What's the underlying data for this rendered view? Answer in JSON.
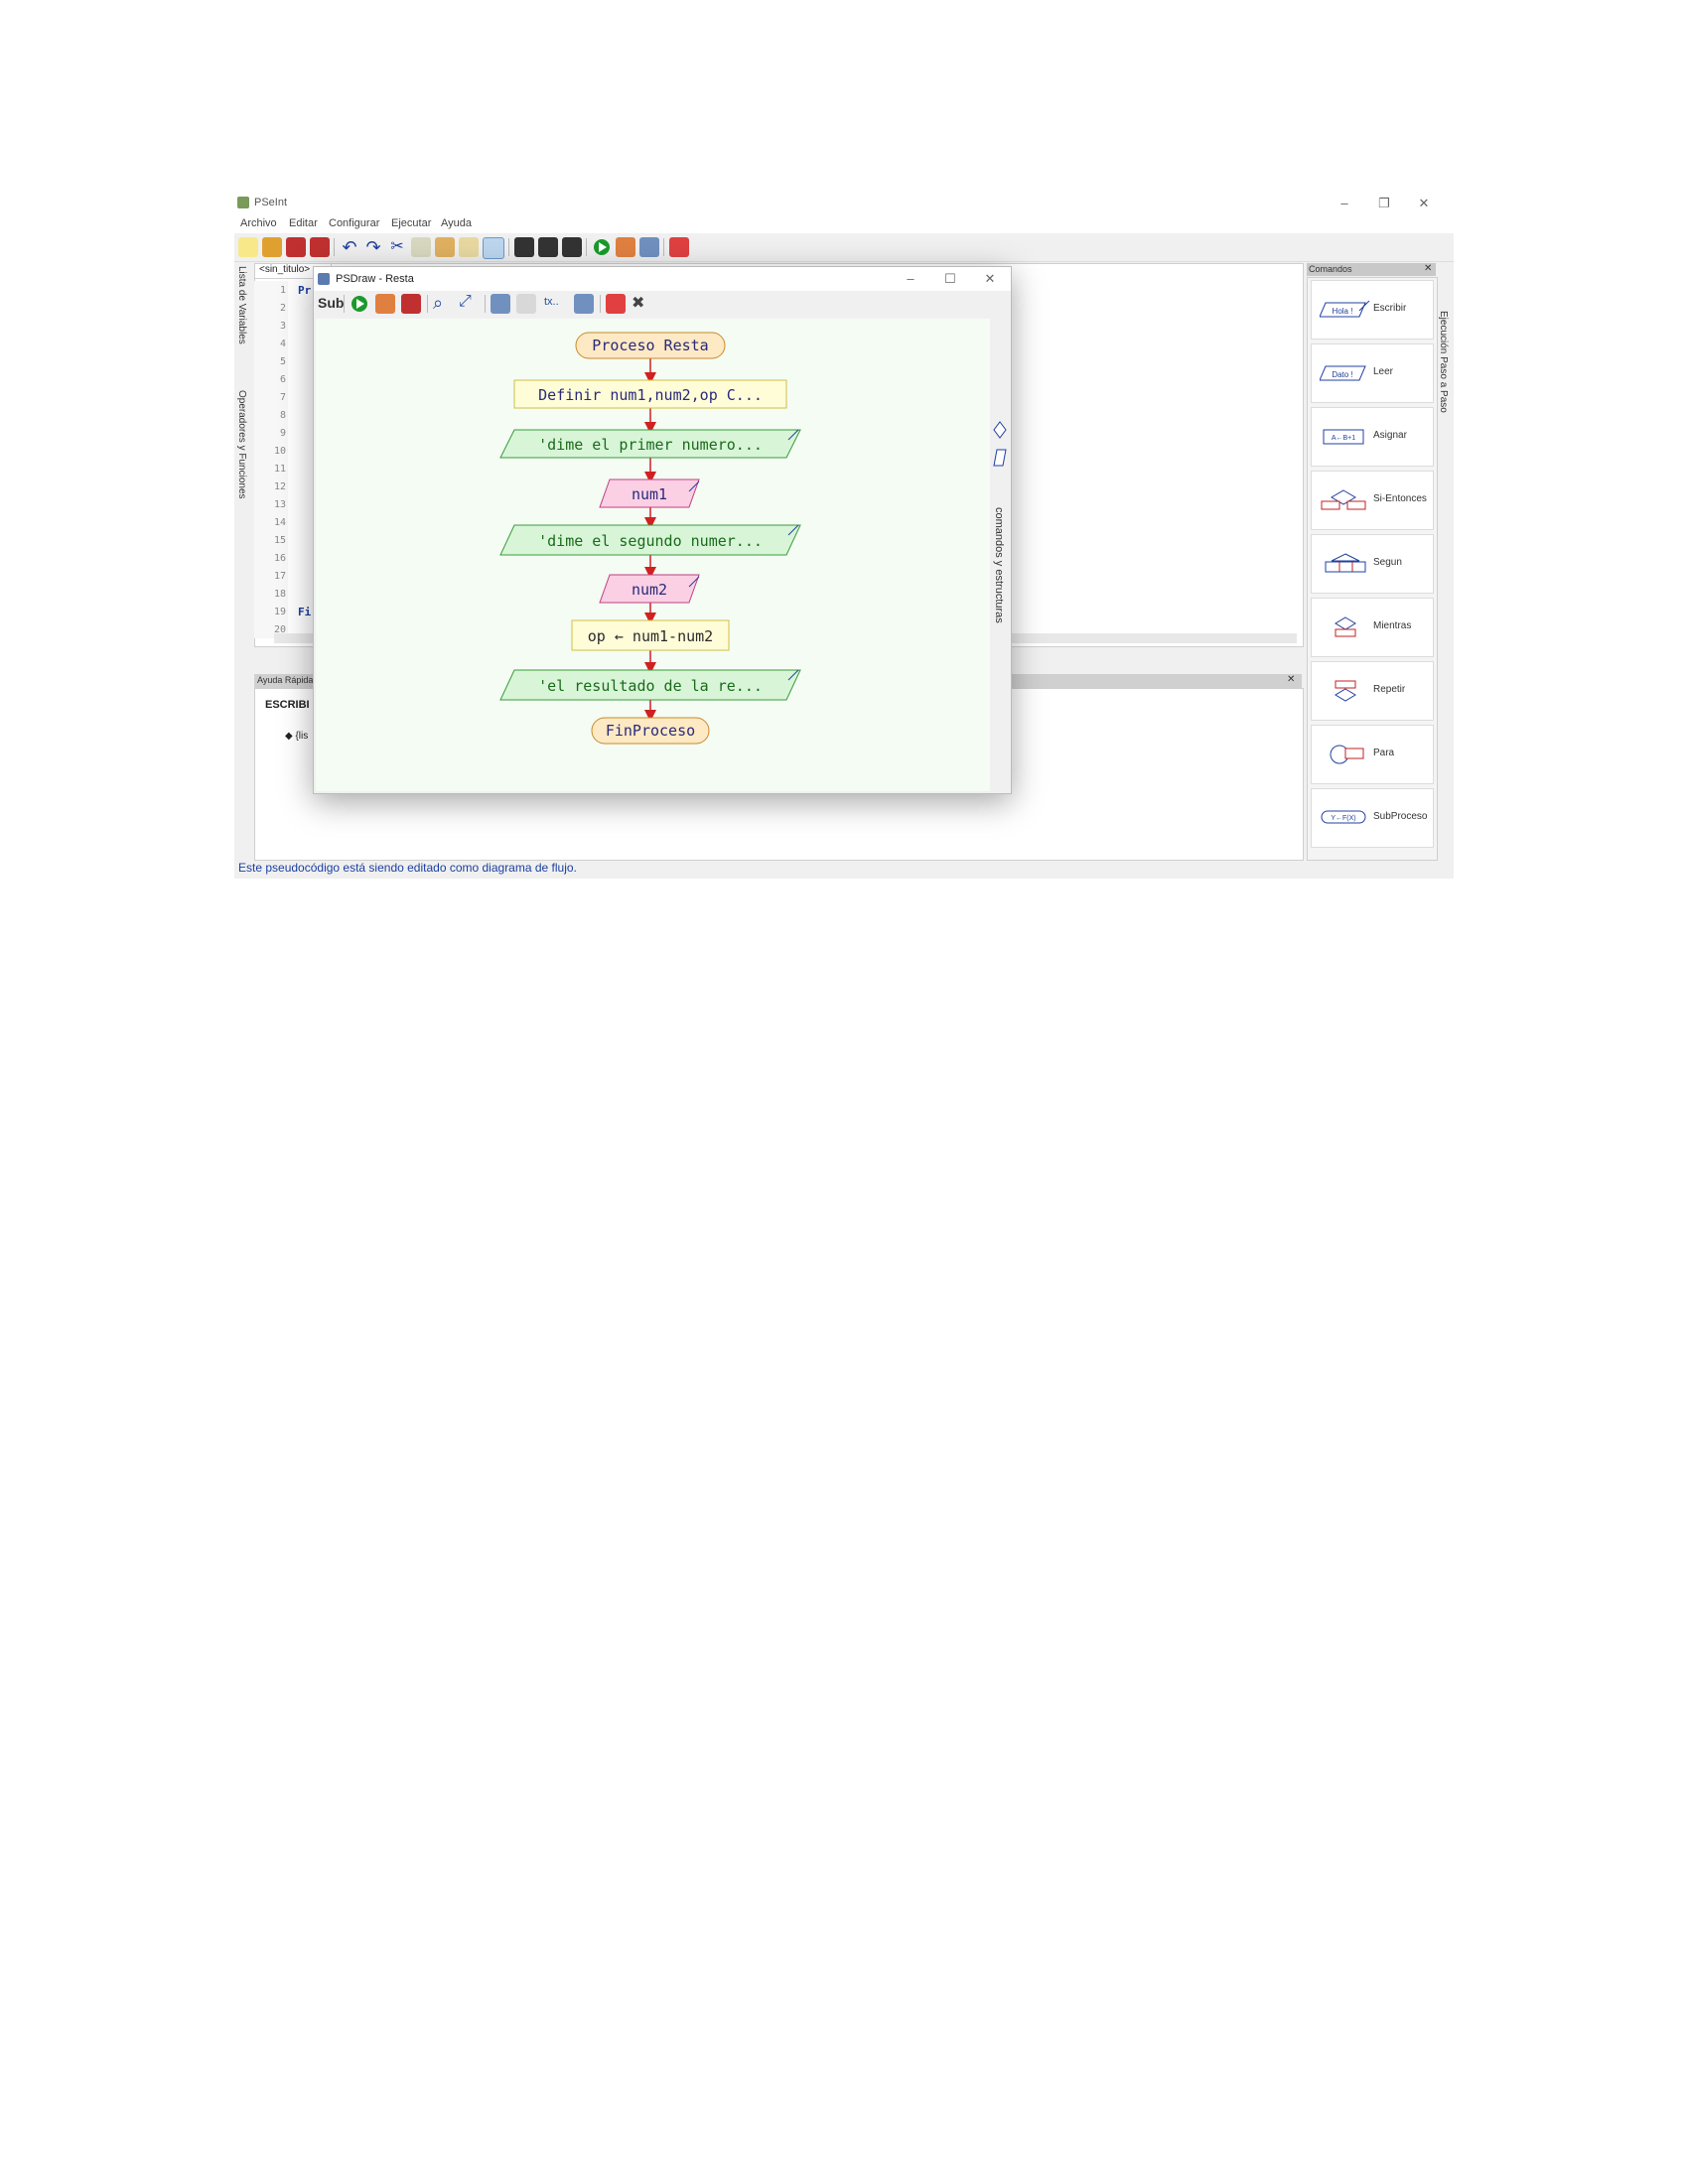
{
  "app": {
    "title": "PSeInt",
    "menu": [
      "Archivo",
      "Editar",
      "Configurar",
      "Ejecutar",
      "Ayuda"
    ]
  },
  "editor": {
    "tab_label": "<sin_titulo>",
    "line_numbers": [
      "1",
      "2",
      "3",
      "4",
      "5",
      "6",
      "7",
      "8",
      "9",
      "10",
      "11",
      "12",
      "13",
      "14",
      "15",
      "16",
      "17",
      "18",
      "19",
      "20"
    ],
    "line1_code": "Pr",
    "line19_code": "Fi"
  },
  "left_tabs": {
    "variables": "Lista de Variables",
    "operators": "Operadores y Funciones"
  },
  "help": {
    "header": "Ayuda Rápida",
    "heading": "ESCRIBI",
    "bullet": "{lis"
  },
  "status_bar": "Este pseudocódigo está siendo editado como diagrama de flujo.",
  "commands": {
    "header": "Comandos",
    "items": [
      {
        "label": "Escribir",
        "icon_text": "Hola !"
      },
      {
        "label": "Leer",
        "icon_text": "Dato !"
      },
      {
        "label": "Asignar",
        "icon_text": "A←B+1"
      },
      {
        "label": "Si-Entonces",
        "icon_text": ""
      },
      {
        "label": "Segun",
        "icon_text": ""
      },
      {
        "label": "Mientras",
        "icon_text": ""
      },
      {
        "label": "Repetir",
        "icon_text": ""
      },
      {
        "label": "Para",
        "icon_text": ""
      },
      {
        "label": "SubProceso",
        "icon_text": "Y←F(X)"
      }
    ],
    "side_tab": "Ejecución Paso a Paso"
  },
  "psdraw": {
    "title": "PSDraw - Resta",
    "sub_button": "Sub",
    "side_tab": "comandos y estructuras",
    "nodes": {
      "start": "Proceso Resta",
      "define": "Definir num1,num2,op C...",
      "out1": "'dime el primer numero...",
      "in1": "num1",
      "out2": "'dime el segundo numer...",
      "in2": "num2",
      "assign": "op ← num1-num2",
      "out3": "'el resultado de la re...",
      "end": "FinProceso"
    }
  },
  "colors": {
    "terminal_fill": "#fde9c4",
    "terminal_stroke": "#c98a2a",
    "define_fill": "#fffdd8",
    "define_stroke": "#d0c040",
    "output_fill": "#d8f5d8",
    "output_stroke": "#3a9a3a",
    "input_fill": "#fbd0e4",
    "input_stroke": "#c04080",
    "arrow": "#d02020",
    "code_text": "#1a3fa0"
  }
}
